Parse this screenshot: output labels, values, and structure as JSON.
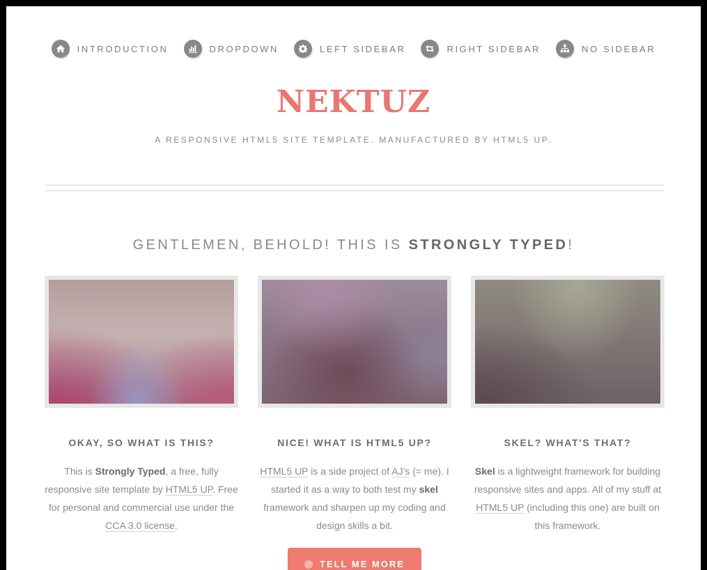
{
  "nav": {
    "items": [
      {
        "label": "Introduction",
        "icon": "home-icon"
      },
      {
        "label": "Dropdown",
        "icon": "bar-chart-icon"
      },
      {
        "label": "Left Sidebar",
        "icon": "gear-icon"
      },
      {
        "label": "Right Sidebar",
        "icon": "retweet-icon"
      },
      {
        "label": "No Sidebar",
        "icon": "sitemap-icon"
      }
    ]
  },
  "header": {
    "logo": "NEKTUZ",
    "tagline": "A responsive HTML5 site template. Manufactured by HTML5 UP."
  },
  "section": {
    "title_prefix": "Gentlemen, behold! This is ",
    "title_strong": "Strongly Typed",
    "title_suffix": "!"
  },
  "features": [
    {
      "heading": "Okay, so what is this?",
      "p": [
        "This is ",
        "Strongly Typed",
        ", a free, fully responsive site template by ",
        "HTML5 UP",
        ". Free for personal and commercial use under the ",
        "CCA 3.0 license",
        "."
      ]
    },
    {
      "heading": "Nice! What is HTML5 UP?",
      "p": [
        "HTML5 UP",
        " is a side project of ",
        "AJ’s",
        " (= me). I started it as a way to both test my ",
        "skel",
        " framework and sharpen up my coding and design skills a bit."
      ]
    },
    {
      "heading": "Skel? What's that?",
      "p": [
        "Skel",
        " is a lightweight framework for building responsive sites and apps. All of my stuff at ",
        "HTML5 UP",
        " (including this one) are built on this framework."
      ]
    }
  ],
  "cta": {
    "label": "Tell Me More",
    "color": "#ee7a70"
  },
  "colors": {
    "accent": "#e97770",
    "text": "#8a8a8a",
    "icon_bg": "#888888"
  }
}
